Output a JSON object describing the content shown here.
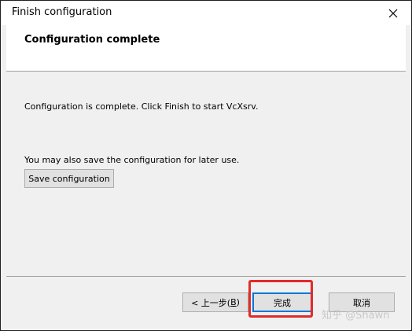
{
  "window": {
    "title": "Finish configuration"
  },
  "header": {
    "title": "Configuration complete"
  },
  "content": {
    "message_1": "Configuration is complete. Click Finish to start VcXsrv.",
    "message_2": "You may also save the configuration for later use.",
    "save_button_label": "Save configuration"
  },
  "footer": {
    "back_label_prefix": "< 上一步(",
    "back_accelerator": "B",
    "back_label_suffix": ")",
    "finish_label": "完成",
    "cancel_label": "取消"
  },
  "watermark": {
    "text": "知乎 @Shawn"
  },
  "colors": {
    "highlight": "#e02b2b",
    "focus_border": "#0078d7",
    "panel": "#f0f0f0"
  },
  "icons": {
    "close": "close-icon"
  }
}
